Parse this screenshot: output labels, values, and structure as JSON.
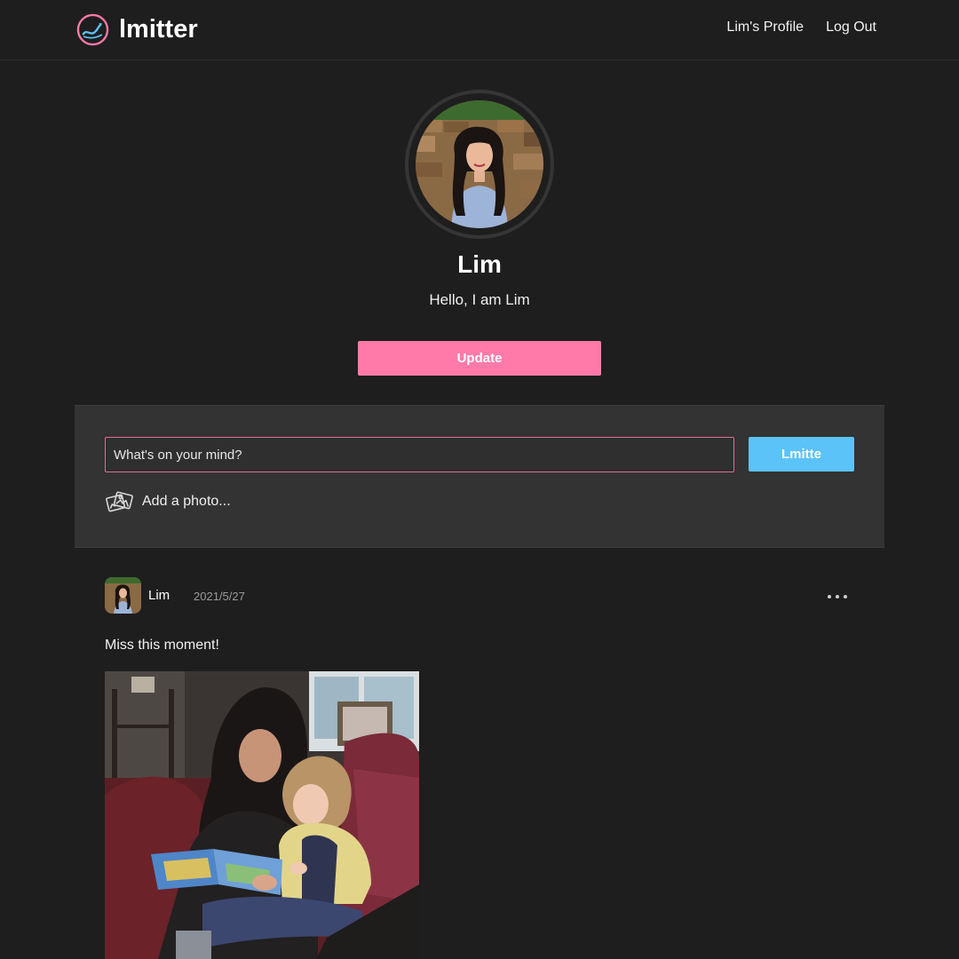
{
  "app": {
    "name": "lmitter"
  },
  "nav": {
    "profile_label": "Lim's Profile",
    "logout_label": "Log Out"
  },
  "profile": {
    "name": "Lim",
    "bio": "Hello, I am Lim",
    "update_label": "Update"
  },
  "composer": {
    "placeholder": "What's on your mind?",
    "value": "",
    "submit_label": "Lmitte",
    "add_photo_label": "Add a photo...",
    "add_photo_icon": "photos-icon"
  },
  "post": {
    "author": "Lim",
    "date": "2021/5/27",
    "text": "Miss this moment!",
    "menu_icon": "more-horizontal-icon"
  },
  "colors": {
    "background": "#1e1e1e",
    "panel": "#333333",
    "update_button": "#ff7aa8",
    "submit_button": "#5bc3f7",
    "input_border": "#e16d92",
    "date_text": "#9a9a9a"
  }
}
